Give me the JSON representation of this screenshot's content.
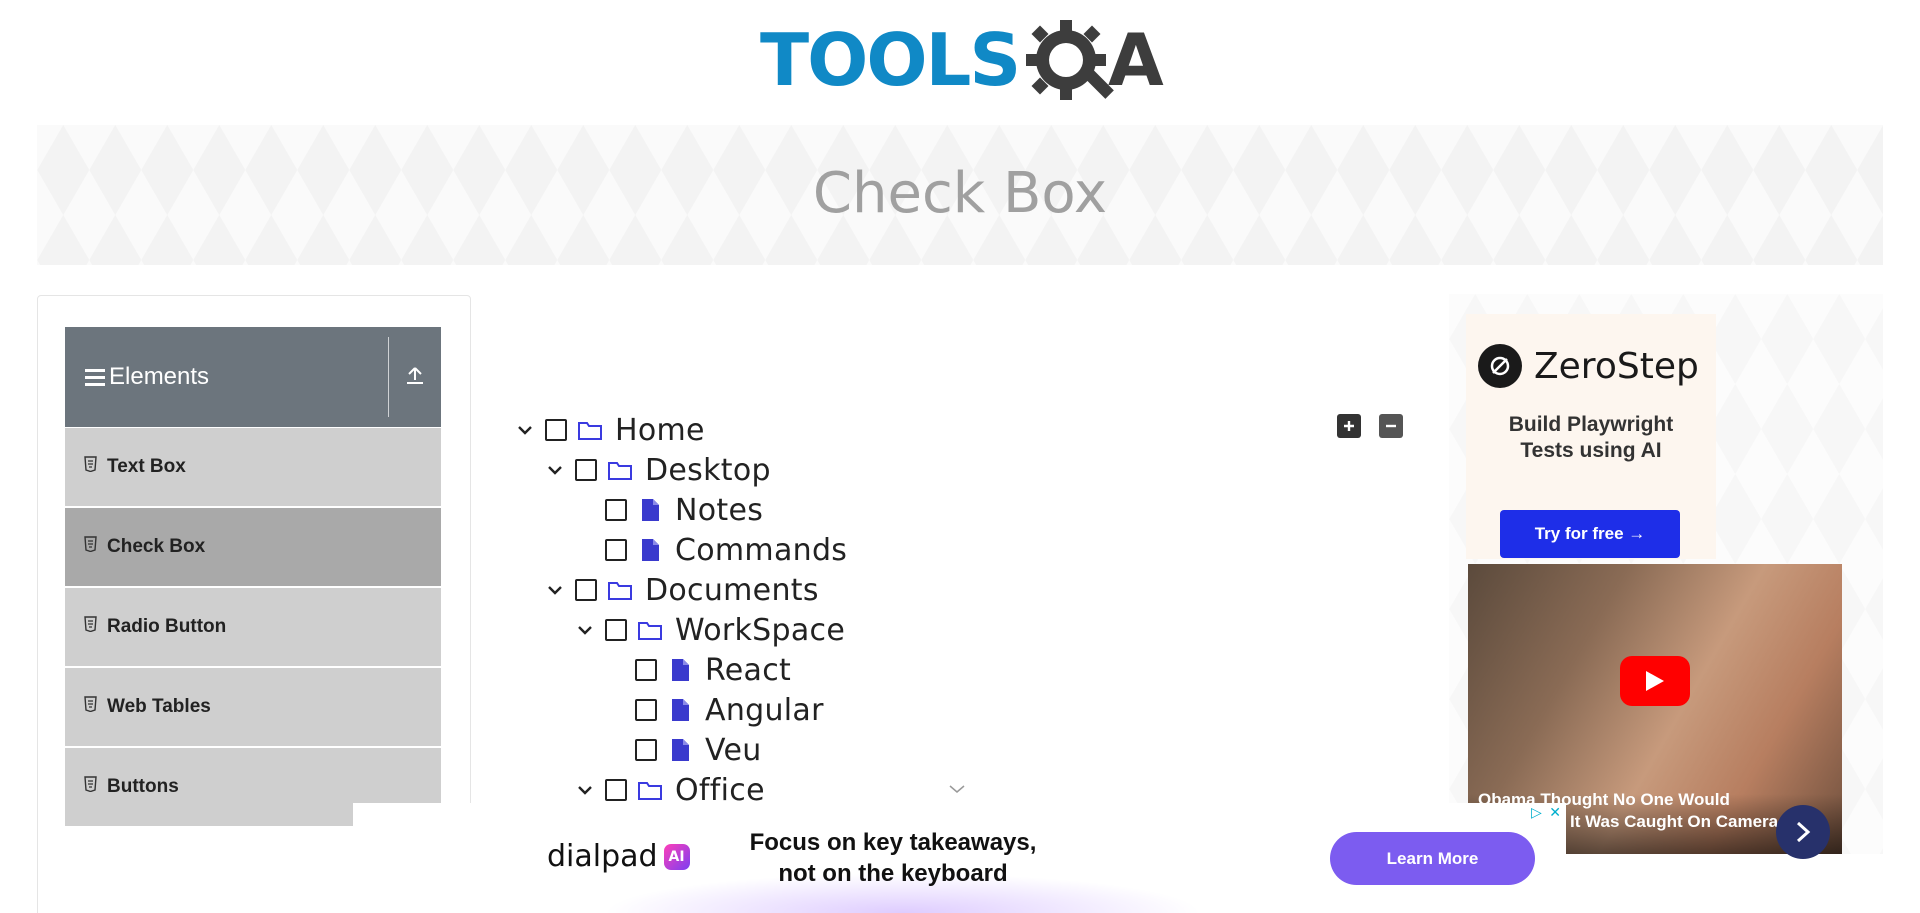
{
  "header": {
    "logo_text": "TOOLS",
    "logo_text_suffix": "A",
    "logo_alt": "ToolsQA"
  },
  "banner": {
    "title": "Check Box"
  },
  "sidebar": {
    "group_title": "Elements",
    "items": [
      {
        "label": "Text Box"
      },
      {
        "label": "Check Box"
      },
      {
        "label": "Radio Button"
      },
      {
        "label": "Web Tables"
      },
      {
        "label": "Buttons"
      }
    ]
  },
  "tree": {
    "nodes": [
      {
        "label": "Home",
        "type": "folder"
      },
      {
        "label": "Desktop",
        "type": "folder"
      },
      {
        "label": "Notes",
        "type": "file"
      },
      {
        "label": "Commands",
        "type": "file"
      },
      {
        "label": "Documents",
        "type": "folder"
      },
      {
        "label": "WorkSpace",
        "type": "folder"
      },
      {
        "label": "React",
        "type": "file"
      },
      {
        "label": "Angular",
        "type": "file"
      },
      {
        "label": "Veu",
        "type": "file"
      },
      {
        "label": "Office",
        "type": "folder"
      }
    ],
    "expand_all_label": "+",
    "collapse_all_label": "−"
  },
  "right_ad": {
    "brand": "ZeroStep",
    "subtitle_line1": "Build Playwright",
    "subtitle_line2": "Tests using AI",
    "cta": "Try for free →",
    "video_caption_line1": "Obama Thought No One Would",
    "video_caption_line2": "It Was Caught On Camera"
  },
  "bottom_ad": {
    "brand": "dialpad",
    "brand_badge": "AI",
    "tagline_line1": "Focus on key takeaways,",
    "tagline_line2": "not on the keyboard",
    "cta": "Learn More"
  },
  "colors": {
    "accent": "#1089c6",
    "folder_icon": "#3a3ae0",
    "file_icon": "#3a3acd",
    "menu_header": "#6c757d",
    "menu_active": "#a9a9a9",
    "menu_item": "#cfcfcf"
  }
}
